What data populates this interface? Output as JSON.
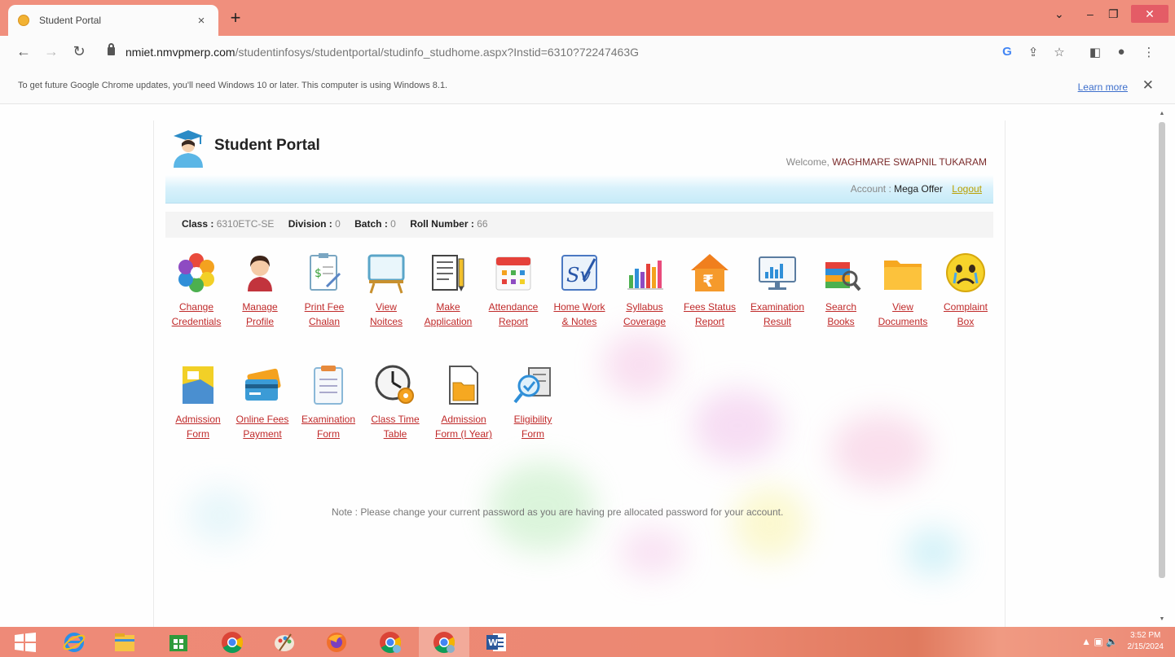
{
  "browser": {
    "tab_title": "Student Portal",
    "tab_close": "×",
    "new_tab": "+",
    "url_domain": "nmiet.nmvpmerp.com",
    "url_path": "/studentinfosys/studentportal/studinfo_studhome.aspx?Instid=6310?72247463G"
  },
  "infobar": {
    "message": "To get future Google Chrome updates, you'll need Windows 10 or later. This computer is using Windows 8.1.",
    "learn_more": "Learn more",
    "close": "✕"
  },
  "header": {
    "title": "Student Portal",
    "welcome_prefix": "Welcome,",
    "student_name": "WAGHMARE SWAPNIL TUKARAM",
    "account_label": "Account :",
    "account_plan": "Mega Offer",
    "logout": "Logout"
  },
  "class_info": {
    "class_label": "Class :",
    "class_value": "6310ETC-SE",
    "division_label": "Division :",
    "division_value": "0",
    "batch_label": "Batch :",
    "batch_value": "0",
    "roll_label": "Roll Number :",
    "roll_value": "66"
  },
  "tiles_row1": [
    {
      "l1": "Change",
      "l2": "Credentials",
      "icon": "gear-icon"
    },
    {
      "l1": "Manage",
      "l2": "Profile",
      "icon": "person-icon"
    },
    {
      "l1": "Print Fee",
      "l2": "Chalan",
      "icon": "receipt-icon"
    },
    {
      "l1": "View",
      "l2": "Noitces",
      "icon": "noticeboard-icon"
    },
    {
      "l1": "Make",
      "l2": "Application",
      "icon": "document-pen-icon"
    },
    {
      "l1": "Attendance",
      "l2": "Report",
      "icon": "calendar-icon"
    },
    {
      "l1": "Home Work",
      "l2": "& Notes",
      "icon": "signature-icon"
    },
    {
      "l1": "Syllabus",
      "l2": "Coverage",
      "icon": "bar-chart-icon"
    },
    {
      "l1": "Fees Status",
      "l2": "Report",
      "icon": "rupee-house-icon"
    },
    {
      "l1": "Examination",
      "l2": "Result",
      "icon": "monitor-chart-icon"
    },
    {
      "l1": "Search",
      "l2": "Books",
      "icon": "book-search-icon"
    },
    {
      "l1": "View",
      "l2": "Documents",
      "icon": "folder-icon"
    },
    {
      "l1": "Complaint",
      "l2": "Box",
      "icon": "crying-face-icon"
    }
  ],
  "tiles_row2": [
    {
      "l1": "Admission",
      "l2": "Form",
      "icon": "form-icon"
    },
    {
      "l1": "Online Fees",
      "l2": "Payment",
      "icon": "credit-card-icon"
    },
    {
      "l1": "Examination",
      "l2": "Form",
      "icon": "clipboard-icon"
    },
    {
      "l1": "Class Time",
      "l2": "Table",
      "icon": "clock-gear-icon"
    },
    {
      "l1": "Admission",
      "l2": "Form (I Year)",
      "icon": "folder-document-icon"
    },
    {
      "l1": "Eligibility",
      "l2": "Form",
      "icon": "magnifier-check-icon"
    }
  ],
  "note": "Note : Please change your current password as you are having pre allocated password for your account.",
  "taskbar": {
    "time": "3:52 PM",
    "date": "2/15/2024"
  },
  "colors": {
    "tab_strip": "#f08f7d",
    "link_red": "#c02a2a",
    "logout_yellow": "#b9a000",
    "blue_bar": "#c7ebf8"
  }
}
